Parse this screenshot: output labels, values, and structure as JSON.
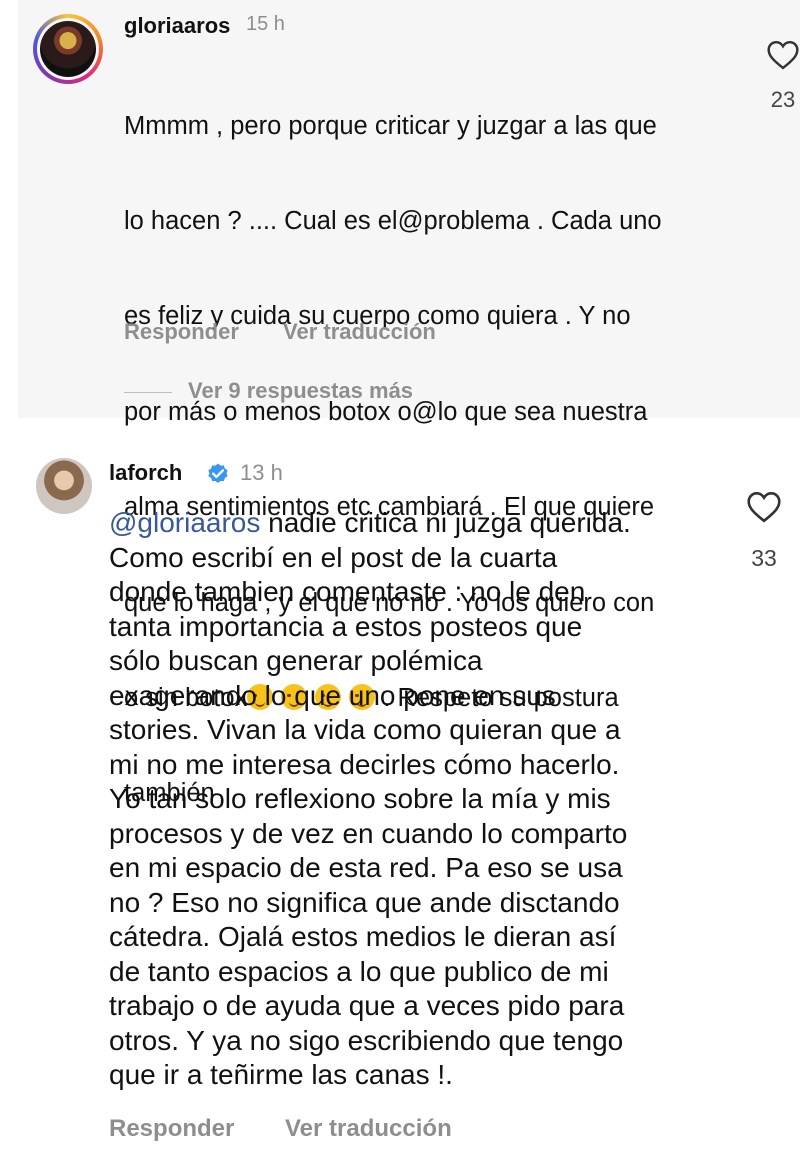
{
  "comment1": {
    "username": "gloriaaros",
    "time": "15 h",
    "lines": [
      "Mmmm , pero porque criticar y juzgar a las que",
      "lo hacen ? .... Cual es el@problema . Cada uno",
      "es feliz y cuida su cuerpo como quiera . Y no",
      "por más o menos botox o@lo que sea nuestra",
      "alma sentimientos etc cambiará . El que quiere",
      "que lo haga , y el que no no . Yo los quiero con"
    ],
    "line7_start": "o sin botox",
    "line7_emojis": [
      "winking-face-emoji",
      "winking-face-emoji",
      "winking-face-emoji",
      "winking-face-emoji"
    ],
    "line7_end": ". Respeto su postura",
    "line8": "también",
    "reply_label": "Responder",
    "translate_label": "Ver traducción",
    "likes": "23",
    "view_more_replies": "Ver 9 respuestas más"
  },
  "comment2": {
    "username": "laforch",
    "time": "13 h",
    "mention": "@gloriaaros",
    "first_line_rest": " nadie critica ni juzga querida.",
    "lines": [
      "Como escribí en el post de la cuarta",
      "donde tambien comentaste : no le den",
      "tanta importancia a estos posteos que",
      "sólo buscan generar polémica",
      "exagerando lo que uno pone en sus",
      "stories. Vivan la vida como quieran que a",
      "mi no me interesa decirles cómo hacerlo.",
      "Yo tan solo reflexiono sobre la mía y mis",
      "procesos y de vez en cuando lo comparto",
      "en mi espacio de esta red. Pa eso se usa",
      "no ? Eso no significa que ande disctando",
      "cátedra. Ojalá estos medios le dieran así",
      "de tanto espacios a lo que publico de mi",
      "trabajo o de ayuda que a veces pido para",
      "otros. Y ya no sigo escribiendo que tengo",
      "que ir a teñirme las canas !."
    ],
    "reply_label": "Responder",
    "translate_label": "Ver traducción",
    "likes": "33"
  },
  "colors": {
    "text": "#111111",
    "muted": "#8e8e8e",
    "mention": "#385898",
    "verified": "#3897f0",
    "panel": "#f6f6f6"
  },
  "icons": [
    "heart-outline-icon",
    "verified-badge-icon"
  ]
}
